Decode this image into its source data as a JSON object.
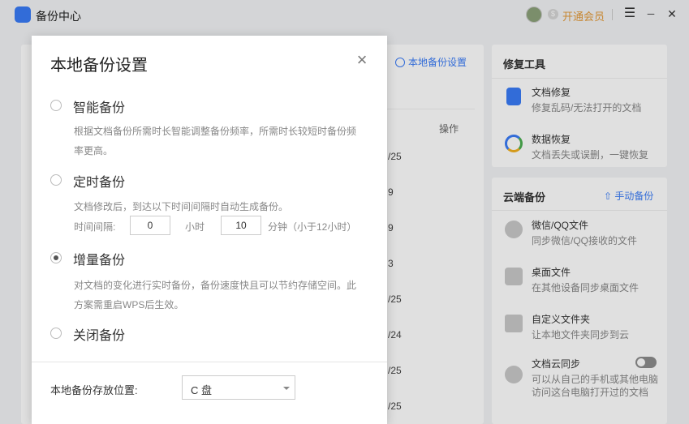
{
  "app": {
    "title": "备份中心",
    "vip_label": "开通会员"
  },
  "titlebar": {
    "menu_glyph": "☰",
    "min_glyph": "─",
    "close_glyph": "✕"
  },
  "main": {
    "local_setting_link": "本地备份设置",
    "col_actions": "操作",
    "date_cells": [
      "/25",
      "9",
      "9",
      "3",
      "/25",
      "/24",
      "/25",
      "/25"
    ]
  },
  "repair": {
    "title": "修复工具",
    "items": [
      {
        "title": "文档修复",
        "desc": "修复乱码/无法打开的文档"
      },
      {
        "title": "数据恢复",
        "desc": "文档丢失或误删，一键恢复"
      }
    ]
  },
  "cloud": {
    "title": "云端备份",
    "manual_label": "手动备份",
    "items": [
      {
        "title": "微信/QQ文件",
        "desc": "同步微信/QQ接收的文件"
      },
      {
        "title": "桌面文件",
        "desc": "在其他设备同步桌面文件"
      },
      {
        "title": "自定义文件夹",
        "desc": "让本地文件夹同步到云"
      },
      {
        "title": "文档云同步",
        "desc": "可以从自己的手机或其他电脑",
        "desc2": "访问这台电脑打开过的文档",
        "enabled": false
      }
    ]
  },
  "dialog": {
    "title": "本地备份设置",
    "options": [
      {
        "label": "智能备份",
        "desc": [
          "根据文档备份所需时长智能调整备份频率，所需时长较短时备份频",
          "率更高。"
        ],
        "checked": false
      },
      {
        "label": "定时备份",
        "desc": [
          "文档修改后，到达以下时间间隔时自动生成备份。"
        ],
        "checked": false
      },
      {
        "label": "增量备份",
        "desc": [
          "对文档的变化进行实时备份，备份速度快且可以节约存储空间。此",
          "方案需重启WPS后生效。"
        ],
        "checked": true
      },
      {
        "label": "关闭备份",
        "desc": [],
        "checked": false
      }
    ],
    "interval": {
      "label": "时间间隔:",
      "hours": "0",
      "hours_unit": "小时",
      "minutes": "10",
      "minutes_unit": "分钟（小于12小时）"
    },
    "location_label": "本地备份存放位置:",
    "location_value": "C 盘"
  },
  "colors": {
    "accent": "#3a7bf6",
    "vip": "#e39a3a"
  }
}
